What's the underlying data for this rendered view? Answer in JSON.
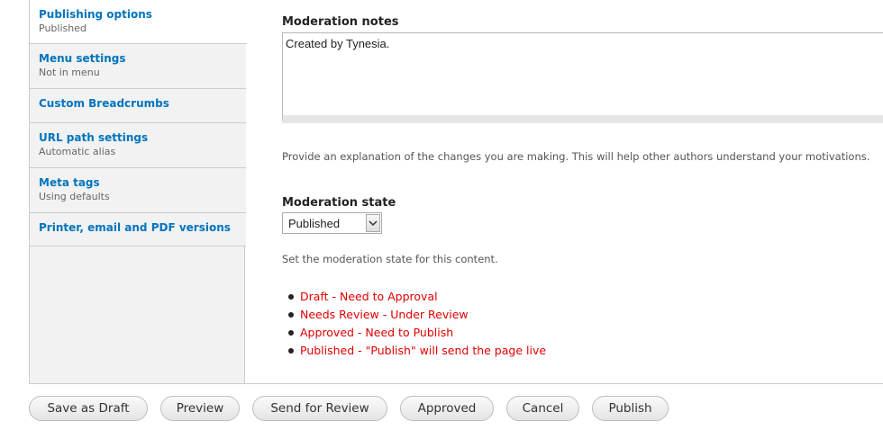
{
  "vertical_tabs": [
    {
      "title": "Publishing options",
      "summary": "Published"
    },
    {
      "title": "Menu settings",
      "summary": "Not in menu"
    },
    {
      "title": "Custom Breadcrumbs",
      "summary": ""
    },
    {
      "title": "URL path settings",
      "summary": "Automatic alias"
    },
    {
      "title": "Meta tags",
      "summary": "Using defaults"
    },
    {
      "title": "Printer, email and PDF versions",
      "summary": ""
    }
  ],
  "moderation": {
    "notes_label": "Moderation notes",
    "notes_value": "Created by Tynesia.",
    "notes_description": "Provide an explanation of the changes you are making. This will help other authors understand your motivations.",
    "state_label": "Moderation state",
    "state_value": "Published",
    "state_description": "Set the moderation state for this content.",
    "state_help": [
      "Draft - Need to Approval",
      "Needs Review - Under Review",
      "Approved - Need to Publish",
      "Published - \"Publish\" will send the page live"
    ]
  },
  "actions": {
    "save_draft": "Save as Draft",
    "preview": "Preview",
    "send_review": "Send for Review",
    "approved": "Approved",
    "cancel": "Cancel",
    "publish": "Publish"
  },
  "colors": {
    "link": "#0074bd",
    "help_text": "#e00000"
  }
}
